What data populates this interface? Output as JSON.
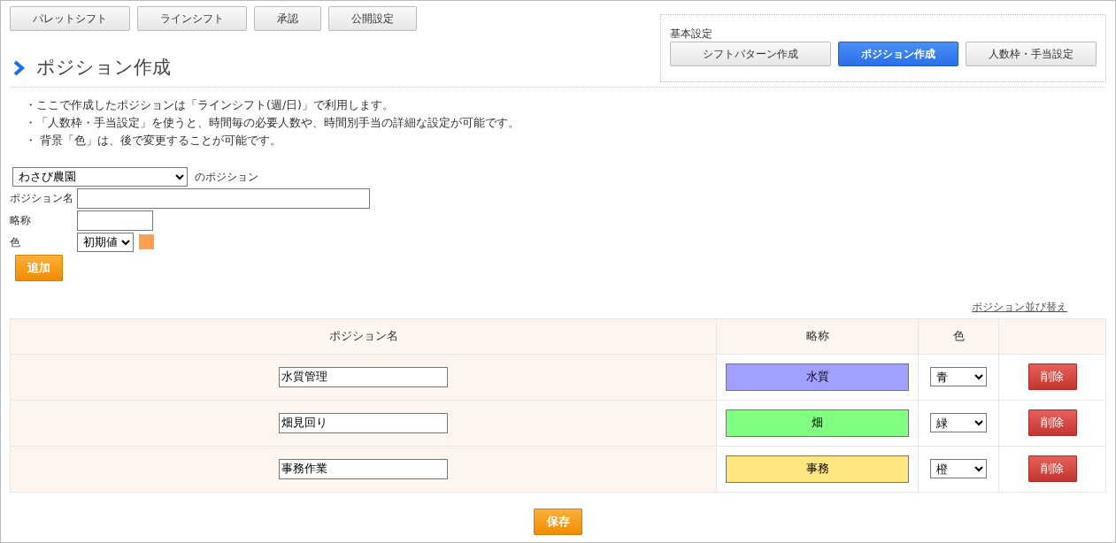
{
  "top_buttons": [
    {
      "label": "パレットシフト"
    },
    {
      "label": "ラインシフト"
    },
    {
      "label": "承認"
    },
    {
      "label": "公開設定"
    }
  ],
  "settings": {
    "title": "基本設定",
    "tabs": [
      {
        "label": "シフトパターン作成",
        "selected": false
      },
      {
        "label": "ポジション作成",
        "selected": true
      },
      {
        "label": "人数枠・手当設定",
        "selected": false
      }
    ]
  },
  "page_title": "ポジション作成",
  "notes": [
    "・ここで作成したポジションは「ラインシフト(週/日)」で利用します。",
    "・「人数枠・手当設定」を使うと、時間毎の必要人数や、時間別手当の詳細な設定が可能です。",
    "・ 背景「色」は、後で変更することが可能です。"
  ],
  "form": {
    "location": {
      "value": "わさび農園",
      "suffix": "のポジション"
    },
    "name": {
      "label": "ポジション名"
    },
    "abbr": {
      "label": "略称"
    },
    "color": {
      "label": "色",
      "value": "初期値",
      "color": "#ffa050"
    },
    "add_button": "追加"
  },
  "sort_link": "ポジション並び替え",
  "table": {
    "columns": [
      "ポジション名",
      "略称",
      "色"
    ],
    "rows": [
      {
        "name": "水質管理",
        "abbr": "水質",
        "color_name": "青",
        "color": "#a0a0ff",
        "delete_label": "削除"
      },
      {
        "name": "畑見回り",
        "abbr": "畑",
        "color_name": "緑",
        "color": "#80ff80",
        "delete_label": "削除"
      },
      {
        "name": "事務作業",
        "abbr": "事務",
        "color_name": "橙",
        "color": "#ffe680",
        "delete_label": "削除"
      }
    ]
  },
  "save_button": "保存"
}
